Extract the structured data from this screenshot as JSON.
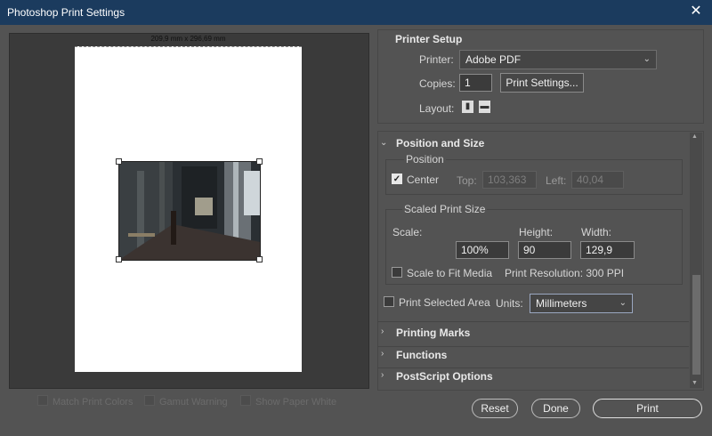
{
  "window": {
    "title": "Photoshop Print Settings"
  },
  "preview": {
    "paper_dimensions": "209,9 mm x 296,69 mm",
    "options": [
      {
        "label": "Match Print Colors"
      },
      {
        "label": "Gamut Warning"
      },
      {
        "label": "Show Paper White"
      }
    ]
  },
  "printer_setup": {
    "heading": "Printer Setup",
    "printer_label": "Printer:",
    "printer_value": "Adobe PDF",
    "copies_label": "Copies:",
    "copies_value": "1",
    "print_settings_button": "Print Settings...",
    "layout_label": "Layout:"
  },
  "position_and_size": {
    "heading": "Position and Size",
    "position_group": "Position",
    "center_label": "Center",
    "center_checked": true,
    "top_label": "Top:",
    "top_value": "103,363",
    "left_label": "Left:",
    "left_value": "40,04",
    "scaled_group": "Scaled Print Size",
    "scale_label": "Scale:",
    "scale_value": "100%",
    "height_label": "Height:",
    "height_value": "90",
    "width_label": "Width:",
    "width_value": "129,9",
    "scale_to_fit_label": "Scale to Fit Media",
    "print_resolution": "Print Resolution: 300 PPI",
    "print_selected_area_label": "Print Selected Area",
    "units_label": "Units:",
    "units_value": "Millimeters"
  },
  "collapsed_sections": [
    {
      "label": "Printing Marks"
    },
    {
      "label": "Functions"
    },
    {
      "label": "PostScript Options"
    }
  ],
  "footer": {
    "reset": "Reset",
    "done": "Done",
    "print": "Print"
  }
}
